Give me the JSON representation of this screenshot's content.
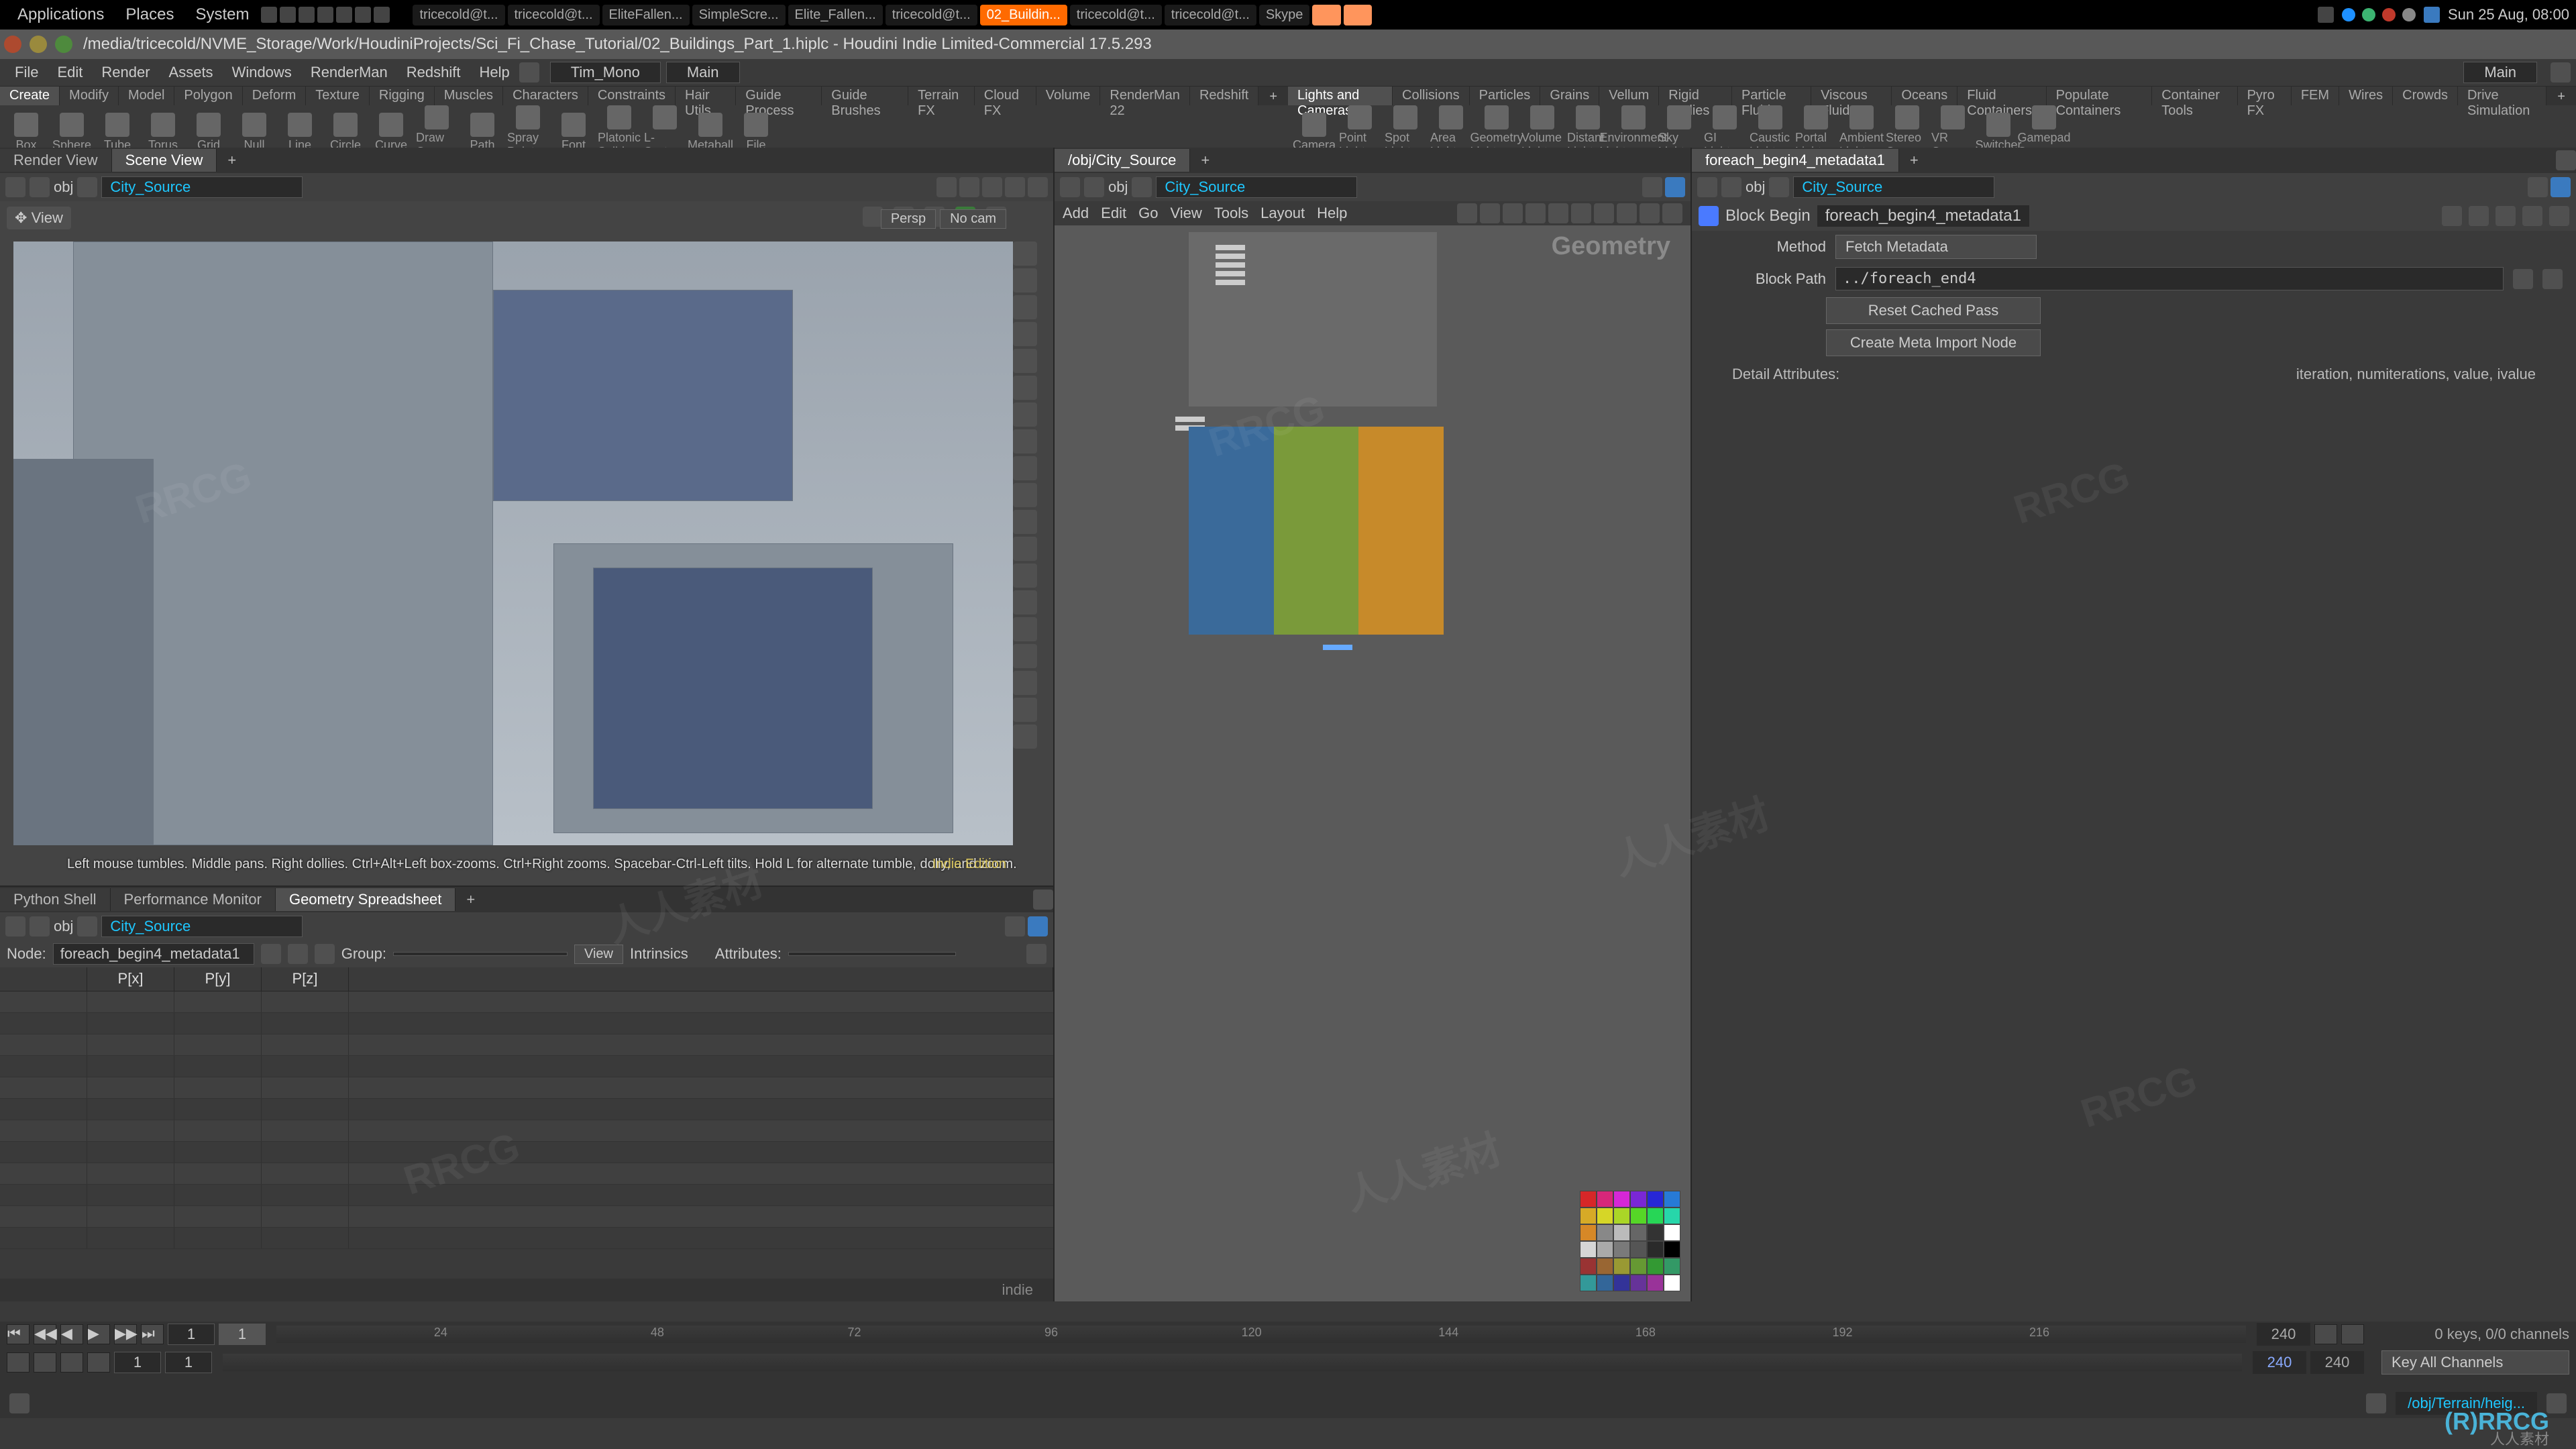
{
  "system": {
    "menu": [
      "Applications",
      "Places",
      "System"
    ],
    "taskbar": [
      {
        "label": "tricecold@t...",
        "active": false
      },
      {
        "label": "tricecold@t...",
        "active": false
      },
      {
        "label": "EliteFallen...",
        "active": false
      },
      {
        "label": "SimpleScre...",
        "active": false
      },
      {
        "label": "Elite_Fallen...",
        "active": false
      },
      {
        "label": "tricecold@t...",
        "active": false
      },
      {
        "label": "02_Buildin...",
        "active": true
      },
      {
        "label": "tricecold@t...",
        "active": false
      },
      {
        "label": "tricecold@t...",
        "active": false
      },
      {
        "label": "Skype",
        "active": false
      }
    ],
    "clock": "Sun 25 Aug, 08:00"
  },
  "titlebar": {
    "path": "/media/tricecold/NVME_Storage/Work/HoudiniProjects/Sci_Fi_Chase_Tutorial/02_Buildings_Part_1.hiplc - Houdini Indie Limited-Commercial 17.5.293"
  },
  "appmenu": {
    "items": [
      "File",
      "Edit",
      "Render",
      "Assets",
      "Windows",
      "RenderMan",
      "Redshift",
      "Help"
    ],
    "desk": "Tim_Mono",
    "desk2": "Main"
  },
  "shelf": {
    "left_tabs": [
      "Create",
      "Modify",
      "Model",
      "Polygon",
      "Deform",
      "Texture",
      "Rigging",
      "Muscles",
      "Characters",
      "Constraints",
      "Hair Utils",
      "Guide Process",
      "Guide Brushes",
      "Terrain FX",
      "Cloud FX",
      "Volume",
      "RenderMan 22",
      "Redshift"
    ],
    "left_tab_sel": 0,
    "left_items": [
      "Box",
      "Sphere",
      "Tube",
      "Torus",
      "Grid",
      "Null",
      "Line",
      "Circle",
      "Curve",
      "Draw Curve",
      "Path",
      "Spray Paint",
      "Font",
      "Platonic Solids",
      "L-System",
      "Metaball",
      "File"
    ],
    "right_tabs": [
      "Lights and Cameras",
      "Collisions",
      "Particles",
      "Grains",
      "Vellum",
      "Rigid Bodies",
      "Particle Fluids",
      "Viscous Fluids",
      "Oceans",
      "Fluid Containers",
      "Populate Containers",
      "Container Tools",
      "Pyro FX",
      "FEM",
      "Wires",
      "Crowds",
      "Drive Simulation"
    ],
    "right_tab_sel": 0,
    "right_items": [
      "Camera",
      "Point Light",
      "Spot Light",
      "Area Light",
      "Geometry Light",
      "Volume Light",
      "Distant Light",
      "Environment Light",
      "Sky Light",
      "GI Light",
      "Caustic Light",
      "Portal Light",
      "Ambient Light",
      "Stereo Camera",
      "VR Camera",
      "Switcher",
      "Gamepad Camera"
    ]
  },
  "viewport": {
    "tabs": [
      "Render View",
      "Scene View"
    ],
    "tab_sel": 1,
    "path": "City_Source",
    "view_label": "View",
    "dd_persp": "Persp",
    "dd_cam": "No cam",
    "hint": "Left mouse tumbles. Middle pans. Right dollies. Ctrl+Alt+Left box-zooms. Ctrl+Right zooms. Spacebar-Ctrl-Left tilts. Hold L for alternate tumble, dolly, and zoom.",
    "indie": "Indie Edition"
  },
  "spreadsheet": {
    "tabs": [
      "Python Shell",
      "Performance Monitor",
      "Geometry Spreadsheet"
    ],
    "tab_sel": 2,
    "path": "City_Source",
    "node_label": "Node:",
    "node_value": "foreach_begin4_metadata1",
    "group_label": "Group:",
    "view_label": "View",
    "intrinsics_label": "Intrinsics",
    "attributes_label": "Attributes:",
    "cols": [
      "",
      "P[x]",
      "P[y]",
      "P[z]",
      ""
    ],
    "footer": "indie"
  },
  "network": {
    "tabs": [
      "/obj/City_Source"
    ],
    "path": "City_Source",
    "menu": [
      "Add",
      "Edit",
      "Go",
      "View",
      "Tools",
      "Layout",
      "Help"
    ],
    "context_label": "Geometry",
    "palette": [
      "#d62728",
      "#d6277a",
      "#d627d6",
      "#7a27d6",
      "#2727d6",
      "#277ad6",
      "#d6aa27",
      "#d6d627",
      "#aad627",
      "#56d627",
      "#27d656",
      "#27d6aa",
      "#d68827",
      "#888888",
      "#bbbbbb",
      "#666666",
      "#333333",
      "#ffffff",
      "#d6d6d6",
      "#aaaaaa",
      "#7a7a7a",
      "#555555",
      "#2a2a2a",
      "#000000",
      "#993333",
      "#996633",
      "#999933",
      "#669933",
      "#339933",
      "#339966",
      "#339999",
      "#336699",
      "#333399",
      "#663399",
      "#993399",
      "#ffffff"
    ]
  },
  "params": {
    "tabs": [
      "foreach_begin4_metadata1"
    ],
    "path": "City_Source",
    "nodetype": "Block Begin",
    "nodename": "foreach_begin4_metadata1",
    "method_label": "Method",
    "method_value": "Fetch Metadata",
    "blockpath_label": "Block Path",
    "blockpath_value": "../foreach_end4",
    "btn1": "Reset Cached Pass",
    "btn2": "Create Meta Import Node",
    "detail_label": "Detail Attributes:",
    "detail_value": "iteration, numiterations, value, ivalue"
  },
  "timeline": {
    "start": "1",
    "cur": "1",
    "end": "240",
    "gend": "240",
    "keys_label": "0 keys, 0/0 channels",
    "allchan_label": "Key All Channels"
  },
  "status": {
    "path": "/obj/Terrain/heig..."
  },
  "watermark": "RRCG",
  "watermark2": "人人素材"
}
